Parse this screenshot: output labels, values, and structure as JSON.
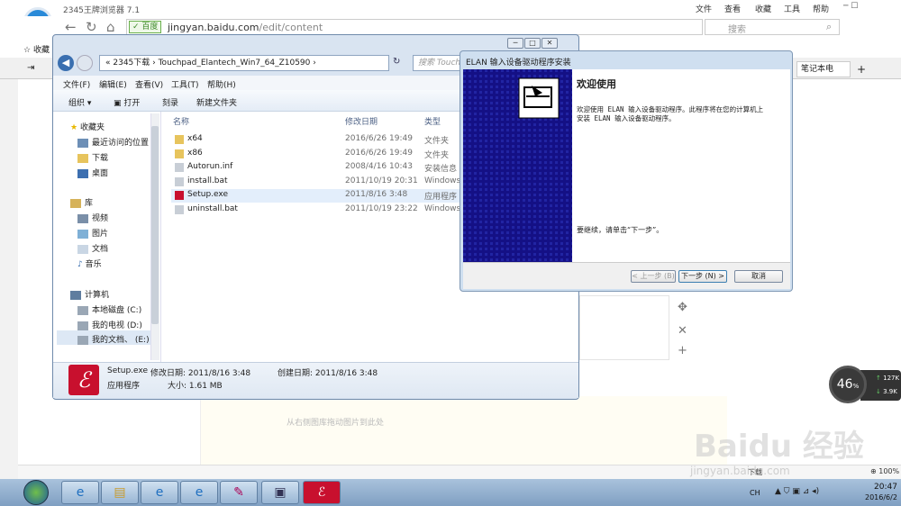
{
  "browser": {
    "name": "2345王牌浏览器 7.1",
    "menu": [
      "文件",
      "查看",
      "收藏",
      "工具",
      "帮助"
    ],
    "url_secure_label": "百度",
    "url_host": "jingyan.baidu.com",
    "url_path": "/edit/content",
    "search_placeholder": "搜索",
    "fav_label": "收藏",
    "tab_right_label": "笔记本电"
  },
  "explorer": {
    "breadcrumb": "« 2345下载 › Touchpad_Elantech_Win7_64_Z10590 ›",
    "search_placeholder": "搜索 Touch",
    "menu": [
      "文件(F)",
      "编辑(E)",
      "查看(V)",
      "工具(T)",
      "帮助(H)"
    ],
    "commands": [
      "组织 ▾",
      "打开",
      "刻录",
      "新建文件夹"
    ],
    "nav": {
      "favorites_header": "收藏夹",
      "favorites": [
        "最近访问的位置",
        "下载",
        "桌面"
      ],
      "library_header": "库",
      "library": [
        "视频",
        "图片",
        "文档",
        "音乐"
      ],
      "computer_header": "计算机",
      "computer": [
        "本地磁盘 (C:)",
        "我的电视 (D:)",
        "我的文档、 (E:)"
      ]
    },
    "columns": {
      "name": "名称",
      "date": "修改日期",
      "type": "类型"
    },
    "files": [
      {
        "name": "x64",
        "date": "2016/6/26 19:49",
        "type": "文件夹",
        "icon": "folder-icon"
      },
      {
        "name": "x86",
        "date": "2016/6/26 19:49",
        "type": "文件夹",
        "icon": "folder-icon"
      },
      {
        "name": "Autorun.inf",
        "date": "2008/4/16 10:43",
        "type": "安装信息",
        "icon": "file-icon"
      },
      {
        "name": "install.bat",
        "date": "2011/10/19 20:31",
        "type": "Windows",
        "icon": "file-icon"
      },
      {
        "name": "Setup.exe",
        "date": "2011/8/16 3:48",
        "type": "应用程序",
        "icon": "setup-icon"
      },
      {
        "name": "uninstall.bat",
        "date": "2011/10/19 23:22",
        "type": "Windows",
        "icon": "file-icon"
      }
    ],
    "selected_file_index": 4,
    "details": {
      "name": "Setup.exe",
      "modified_label": "修改日期: 2011/8/16 3:48",
      "created_label": "创建日期: 2011/8/16 3:48",
      "type": "应用程序",
      "size_label": "大小: 1.61 MB"
    }
  },
  "elan_dialog": {
    "title": "ELAN 输入设备驱动程序安装",
    "heading": "欢迎使用",
    "body": "欢迎使用 ELAN 输入设备驱动程序。此程序将在您的计算机上安装 ELAN 输入设备驱动程序。",
    "continue_text": "要继续，请单击“下一步”。",
    "buttons": {
      "prev": "< 上一步 (B)",
      "next": "下一步 (N) >",
      "cancel": "取消"
    }
  },
  "page": {
    "drag_hint": "从右侧图库拖动图片到此处",
    "side_tools": [
      "✥",
      "✕",
      "+"
    ]
  },
  "speed_widget": {
    "percent": "46",
    "percent_unit": "%",
    "up": "127K",
    "down": "3.9K"
  },
  "status_bar": {
    "items": [
      "下载",
      "100%"
    ]
  },
  "taskbar": {
    "ime": "CH",
    "time": "20:47",
    "date": "2016/6/2"
  },
  "watermark": {
    "brand": "Baidu 经验",
    "url": "jingyan.baidu.com"
  }
}
